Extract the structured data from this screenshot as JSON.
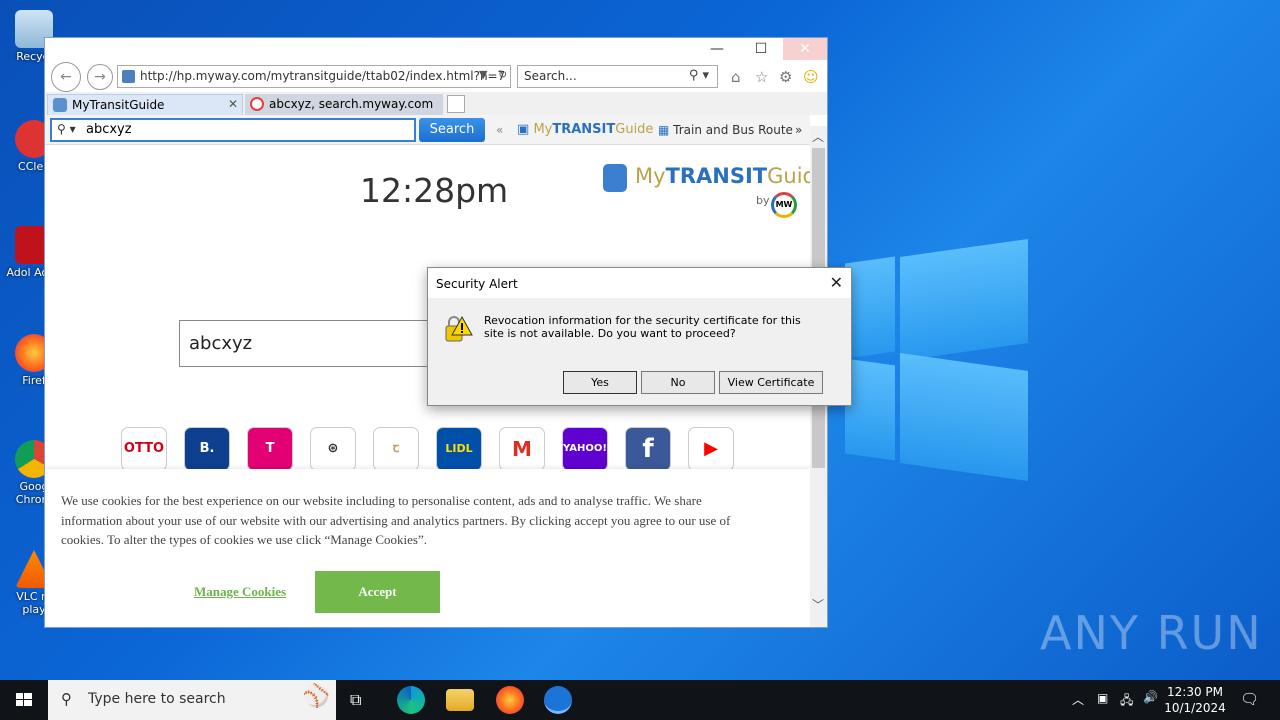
{
  "desktop": {
    "icons": [
      {
        "label": "Recycl"
      },
      {
        "label": "CClea"
      },
      {
        "label": "Adol Acrol"
      },
      {
        "label": "Firef"
      },
      {
        "label": "Goog Chrom"
      },
      {
        "label": "VLC m play"
      }
    ],
    "watermark": "ANY RUN"
  },
  "browser": {
    "address": "http://hp.myway.com/mytransitguide/ttab02/index.html?n=7",
    "search_placeholder": "Search...",
    "tabs": [
      {
        "label": "MyTransitGuide",
        "active": true
      },
      {
        "label": "abcxyz, search.myway.com",
        "active": false
      }
    ],
    "toolbar": {
      "search_value": "abcxyz",
      "search_button": "Search",
      "chevron_left": "«",
      "logo_my": "My",
      "logo_transit": "TRANSIT",
      "logo_guide": "Guide",
      "link": "Train and Bus Route",
      "chevron_right": "»"
    }
  },
  "page": {
    "time": "12:28pm",
    "brand_my": "My",
    "brand_transit": "TRANSIT",
    "brand_guide": "Guide",
    "brand_by": "by",
    "brand_mw": "MW",
    "search_value": "abcxyz",
    "tiles": [
      {
        "name": "otto",
        "text": "OTTO",
        "bg": "#ffffff",
        "fg": "#d6001c"
      },
      {
        "name": "booking",
        "text": "B.",
        "bg": "#0f3f8f",
        "fg": "#ffffff"
      },
      {
        "name": "telekom",
        "text": "T",
        "bg": "#e20074",
        "fg": "#ffffff"
      },
      {
        "name": "plant",
        "text": "⊛",
        "bg": "#ffffff",
        "fg": "#333333"
      },
      {
        "name": "tchibo",
        "text": "ꞇ",
        "bg": "#ffffff",
        "fg": "#c8a060"
      },
      {
        "name": "lidl",
        "text": "LIDL",
        "bg": "#0050aa",
        "fg": "#ffe000"
      },
      {
        "name": "gmail",
        "text": "M",
        "bg": "#ffffff",
        "fg": "#d93025"
      },
      {
        "name": "yahoo",
        "text": "YAHOO!",
        "bg": "#5f01d1",
        "fg": "#ffffff"
      },
      {
        "name": "facebook",
        "text": "f",
        "bg": "#3b5998",
        "fg": "#ffffff"
      },
      {
        "name": "youtube",
        "text": "▶",
        "bg": "#ffffff",
        "fg": "#ff0000"
      }
    ],
    "cookie": {
      "text": "We use cookies for the best experience on our website including to personalise content, ads and to analyse traffic. We share information about your use of our website with our advertising and analytics partners. By clicking accept you agree to our use of cookies. To alter the types of cookies we use click “Manage Cookies”.",
      "manage": "Manage Cookies",
      "accept": "Accept"
    }
  },
  "dialog": {
    "title": "Security Alert",
    "message": "Revocation information for the security certificate for this site is not available. Do you want to proceed?",
    "yes": "Yes",
    "no": "No",
    "view": "View Certificate"
  },
  "taskbar": {
    "search_placeholder": "Type here to search",
    "time": "12:30 PM",
    "date": "10/1/2024"
  }
}
